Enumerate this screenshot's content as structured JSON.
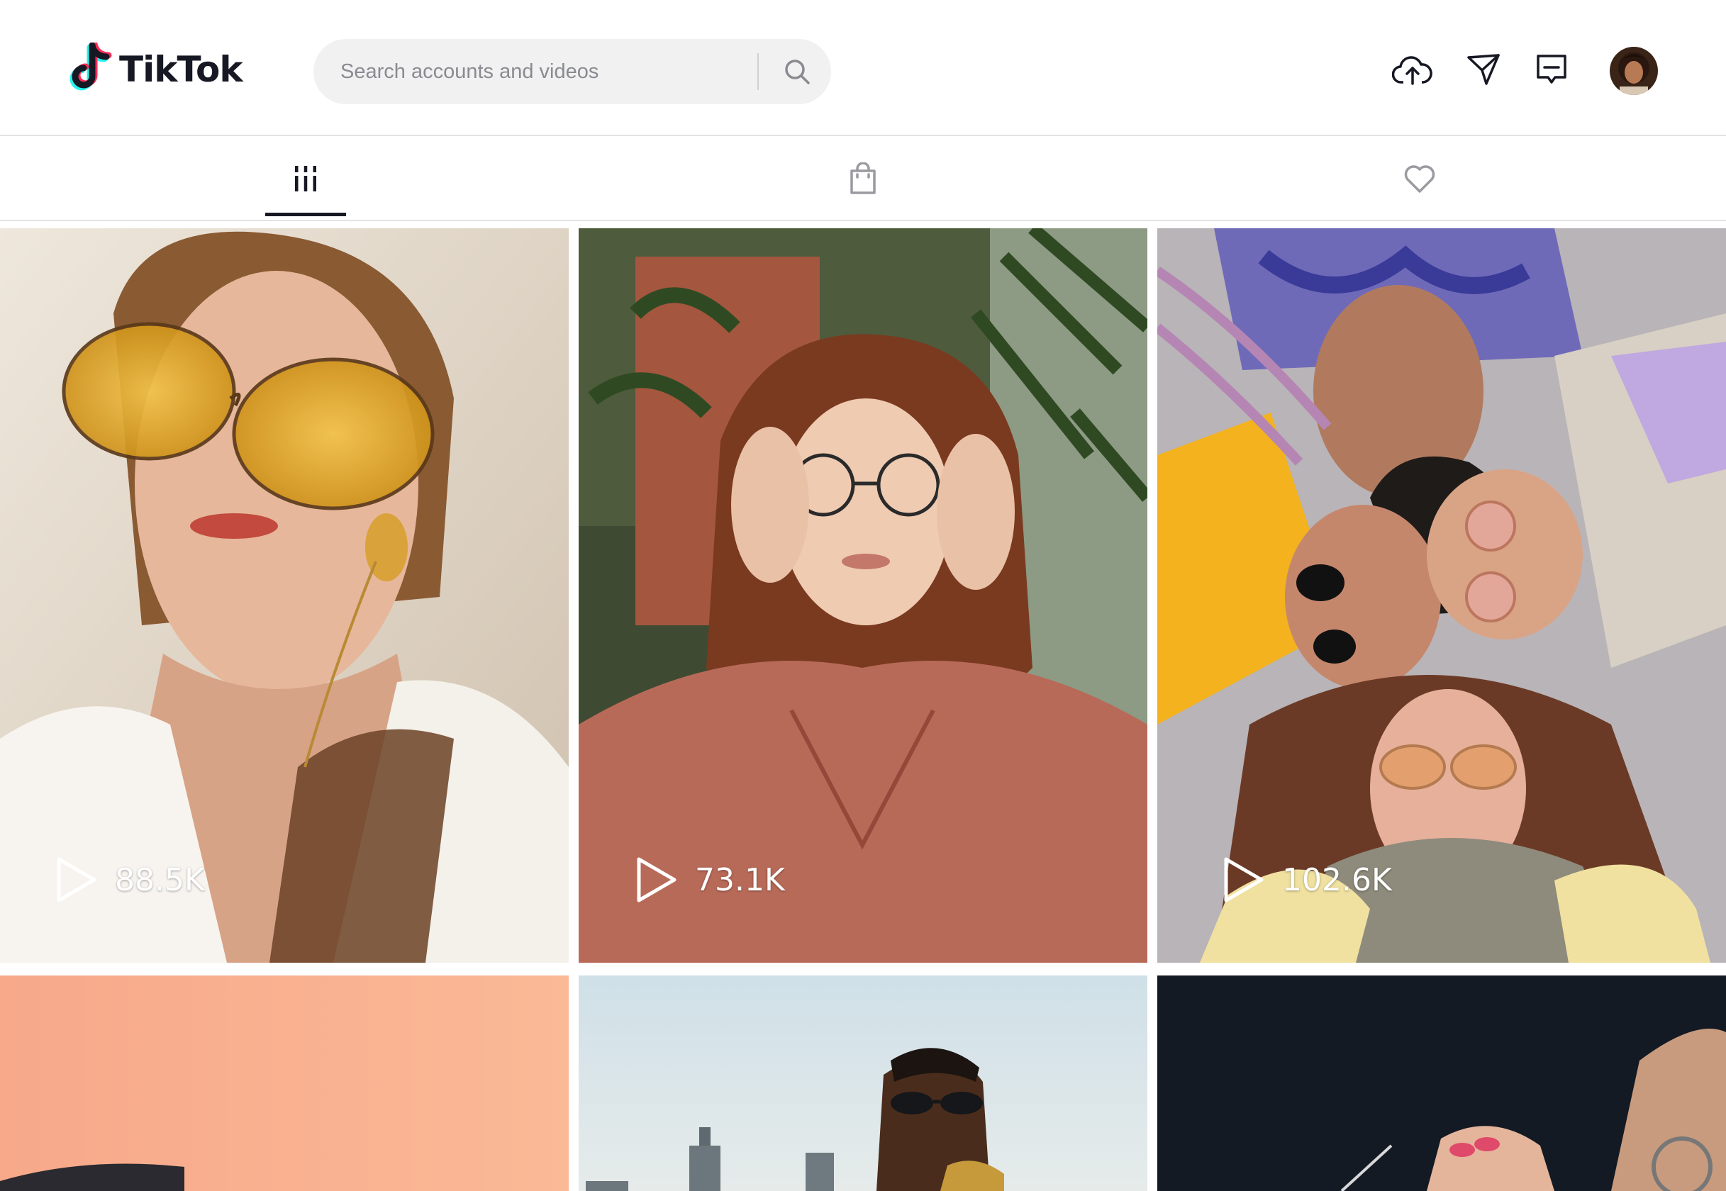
{
  "app": {
    "name": "TikTok",
    "brand_colors": {
      "text": "#161823",
      "cyan": "#25f4ee",
      "pink": "#fe2c55"
    }
  },
  "search": {
    "placeholder": "Search accounts and videos",
    "value": ""
  },
  "header": {
    "icons": [
      "upload-cloud-icon",
      "send-message-icon",
      "inbox-icon"
    ],
    "avatar": "user-avatar"
  },
  "tabs": [
    {
      "name": "videos",
      "icon": "grid-bars-icon",
      "active": true
    },
    {
      "name": "shop",
      "icon": "shopping-bag-icon",
      "active": false
    },
    {
      "name": "liked",
      "icon": "heart-icon",
      "active": false
    }
  ],
  "videos": [
    {
      "views": "88.5K",
      "scene": "woman in yellow aviator sunglasses with shell earring"
    },
    {
      "views": "73.1K",
      "scene": "woman with glasses holding her head, plants behind"
    },
    {
      "views": "102.6K",
      "scene": "group of friends lying on the floor, shot from above"
    },
    {
      "views": "",
      "scene": "peach background with dark curve"
    },
    {
      "views": "",
      "scene": "man in sunglasses playing saxophone, city skyline"
    },
    {
      "views": "",
      "scene": "dark background, hand holding sunglasses"
    }
  ]
}
